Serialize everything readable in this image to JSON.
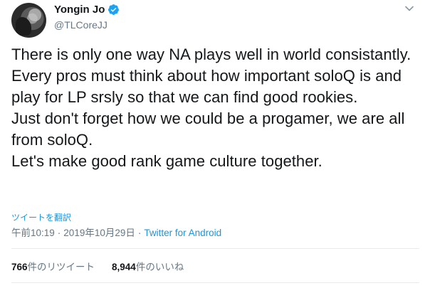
{
  "tweet": {
    "author": {
      "display_name": "Yongin Jo",
      "handle": "@TLCoreJJ",
      "verified": true
    },
    "text": "There is only one way NA plays well in world consistantly.\nEvery pros must think about how important soloQ is and play for LP srsly so that we can find good rookies.\nJust don't forget how we could be a progamer, we are all from soloQ.\nLet's make good rank game culture together.",
    "translate_label": "ツイートを翻訳",
    "time": "午前10:19",
    "separator": "·",
    "date": "2019年10月29日",
    "client": "Twitter for Android",
    "stats": {
      "retweets_count": "766",
      "retweets_label": "件のリツイート",
      "likes_count": "8,944",
      "likes_label": "件のいいね"
    }
  },
  "colors": {
    "link": "#1b95e0",
    "secondary_text": "#657786",
    "verified_badge": "#1da1f2",
    "divider": "#e6ecf0"
  }
}
